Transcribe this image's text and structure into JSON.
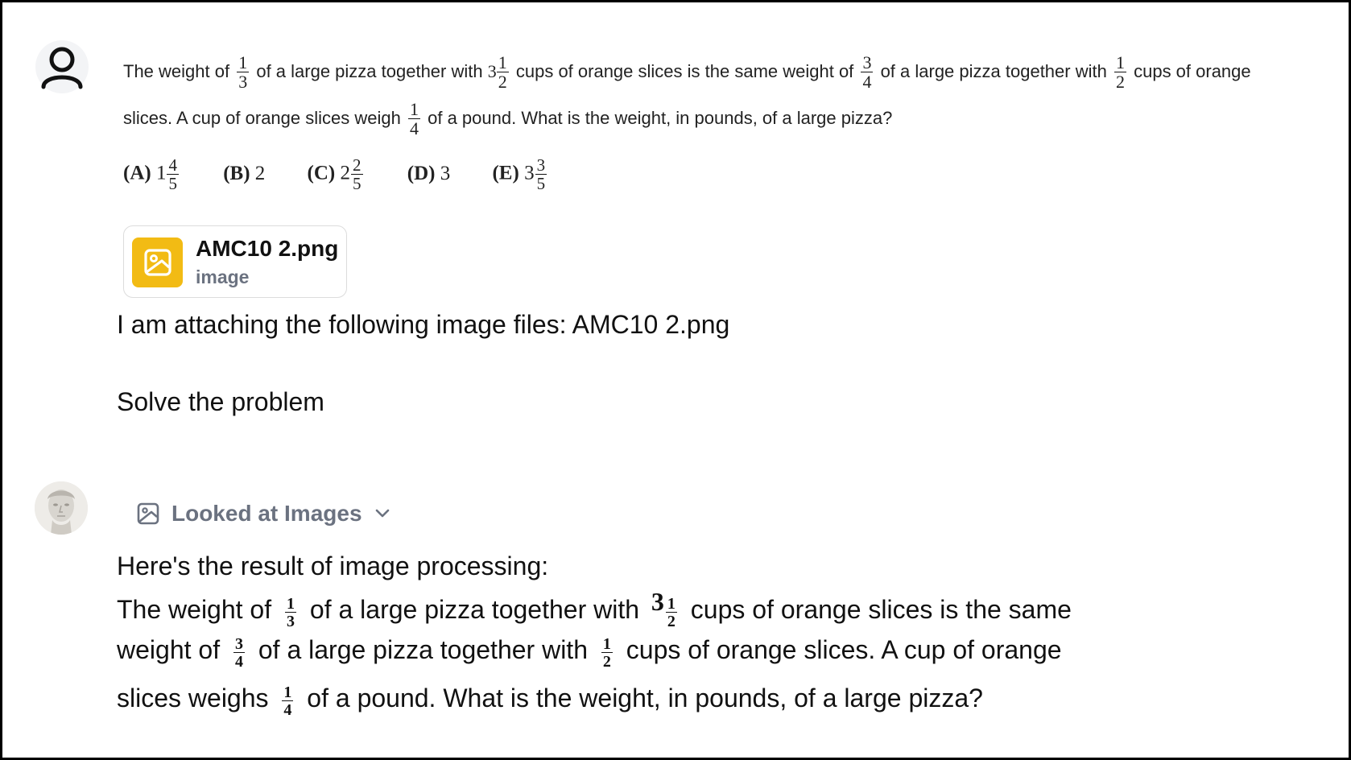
{
  "problem": {
    "line1": {
      "t1": "The weight of",
      "f1": {
        "num": "1",
        "den": "3"
      },
      "t2": "of a large pizza together with",
      "w2": "3",
      "f2": {
        "num": "1",
        "den": "2"
      },
      "t3": "cups of orange slices is the same weight of",
      "f3": {
        "num": "3",
        "den": "4"
      },
      "t4": "of a large pizza together with",
      "f4": {
        "num": "1",
        "den": "2"
      },
      "t5": "cups of orange"
    },
    "line2": {
      "t1": "slices. A cup of orange slices weigh",
      "f1": {
        "num": "1",
        "den": "4"
      },
      "t2": "of a pound. What is the weight, in pounds, of a large pizza?"
    },
    "choices": [
      {
        "label": "(A)",
        "whole": "1",
        "num": "4",
        "den": "5"
      },
      {
        "label": "(B)",
        "whole": "2",
        "num": "",
        "den": ""
      },
      {
        "label": "(C)",
        "whole": "2",
        "num": "2",
        "den": "5"
      },
      {
        "label": "(D)",
        "whole": "3",
        "num": "",
        "den": ""
      },
      {
        "label": "(E)",
        "whole": "3",
        "num": "3",
        "den": "5"
      }
    ]
  },
  "attachment": {
    "name": "AMC10 2.png",
    "type": "image",
    "icon": "image-icon",
    "color": "#f2bb14"
  },
  "user_message": {
    "line1": "I am attaching the following image files: AMC10 2.png",
    "line2": "Solve the problem"
  },
  "assistant": {
    "tool_label": "Looked at Images",
    "tool_icon": "image-icon",
    "intro": "Here's the result of image processing:",
    "r1": {
      "t1": "The weight of",
      "f1": {
        "num": "1",
        "den": "3"
      },
      "t2": "of a large pizza together with",
      "w2": "3",
      "f2": {
        "num": "1",
        "den": "2"
      },
      "t3": "cups of orange slices is the same"
    },
    "r2": {
      "t1": "weight of",
      "f1": {
        "num": "3",
        "den": "4"
      },
      "t2": "of a large pizza together with",
      "f2": {
        "num": "1",
        "den": "2"
      },
      "t3": "cups of orange slices. A cup of orange"
    },
    "r3": {
      "t1": "slices weighs",
      "f1": {
        "num": "1",
        "den": "4"
      },
      "t2": "of a pound. What is the weight, in pounds, of a large pizza?"
    }
  }
}
